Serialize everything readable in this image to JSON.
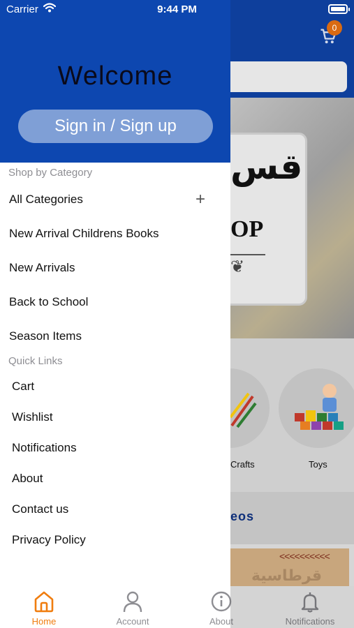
{
  "status_bar": {
    "carrier": "Carrier",
    "time": "9:44 PM"
  },
  "background": {
    "cart_count": "0",
    "banner_arabic": "قس",
    "banner_text": "OP",
    "categories": [
      "Crafts",
      "Toys"
    ],
    "section_text": "eos",
    "promo_arrows": "<<<<<<<<<<",
    "promo_arabic": "قرطاسية"
  },
  "drawer": {
    "welcome": "Welcome",
    "signin_label": "Sign in / Sign up",
    "shop_by_category_label": "Shop by Category",
    "categories": [
      {
        "label": "All Categories",
        "expandable": true
      },
      {
        "label": "New Arrival Childrens Books"
      },
      {
        "label": "New Arrivals"
      },
      {
        "label": "Back to School"
      },
      {
        "label": "Season Items"
      }
    ],
    "quick_links_label": "Quick Links",
    "quick_links": [
      {
        "label": "Cart"
      },
      {
        "label": "Wishlist"
      },
      {
        "label": "Notifications"
      },
      {
        "label": "About"
      },
      {
        "label": "Contact us"
      },
      {
        "label": "Privacy Policy"
      }
    ]
  },
  "tab_bar": {
    "tabs": [
      {
        "label": "Home",
        "icon": "home-icon",
        "active": true
      },
      {
        "label": "Account",
        "icon": "account-icon",
        "active": false
      },
      {
        "label": "About",
        "icon": "info-icon",
        "active": false
      },
      {
        "label": "Notifications",
        "icon": "bell-icon",
        "active": false
      }
    ]
  },
  "colors": {
    "brand_blue": "#0d47b0",
    "signin_button": "#7f9fd6",
    "active_tab": "#f07d0f",
    "badge": "#d96a12"
  }
}
